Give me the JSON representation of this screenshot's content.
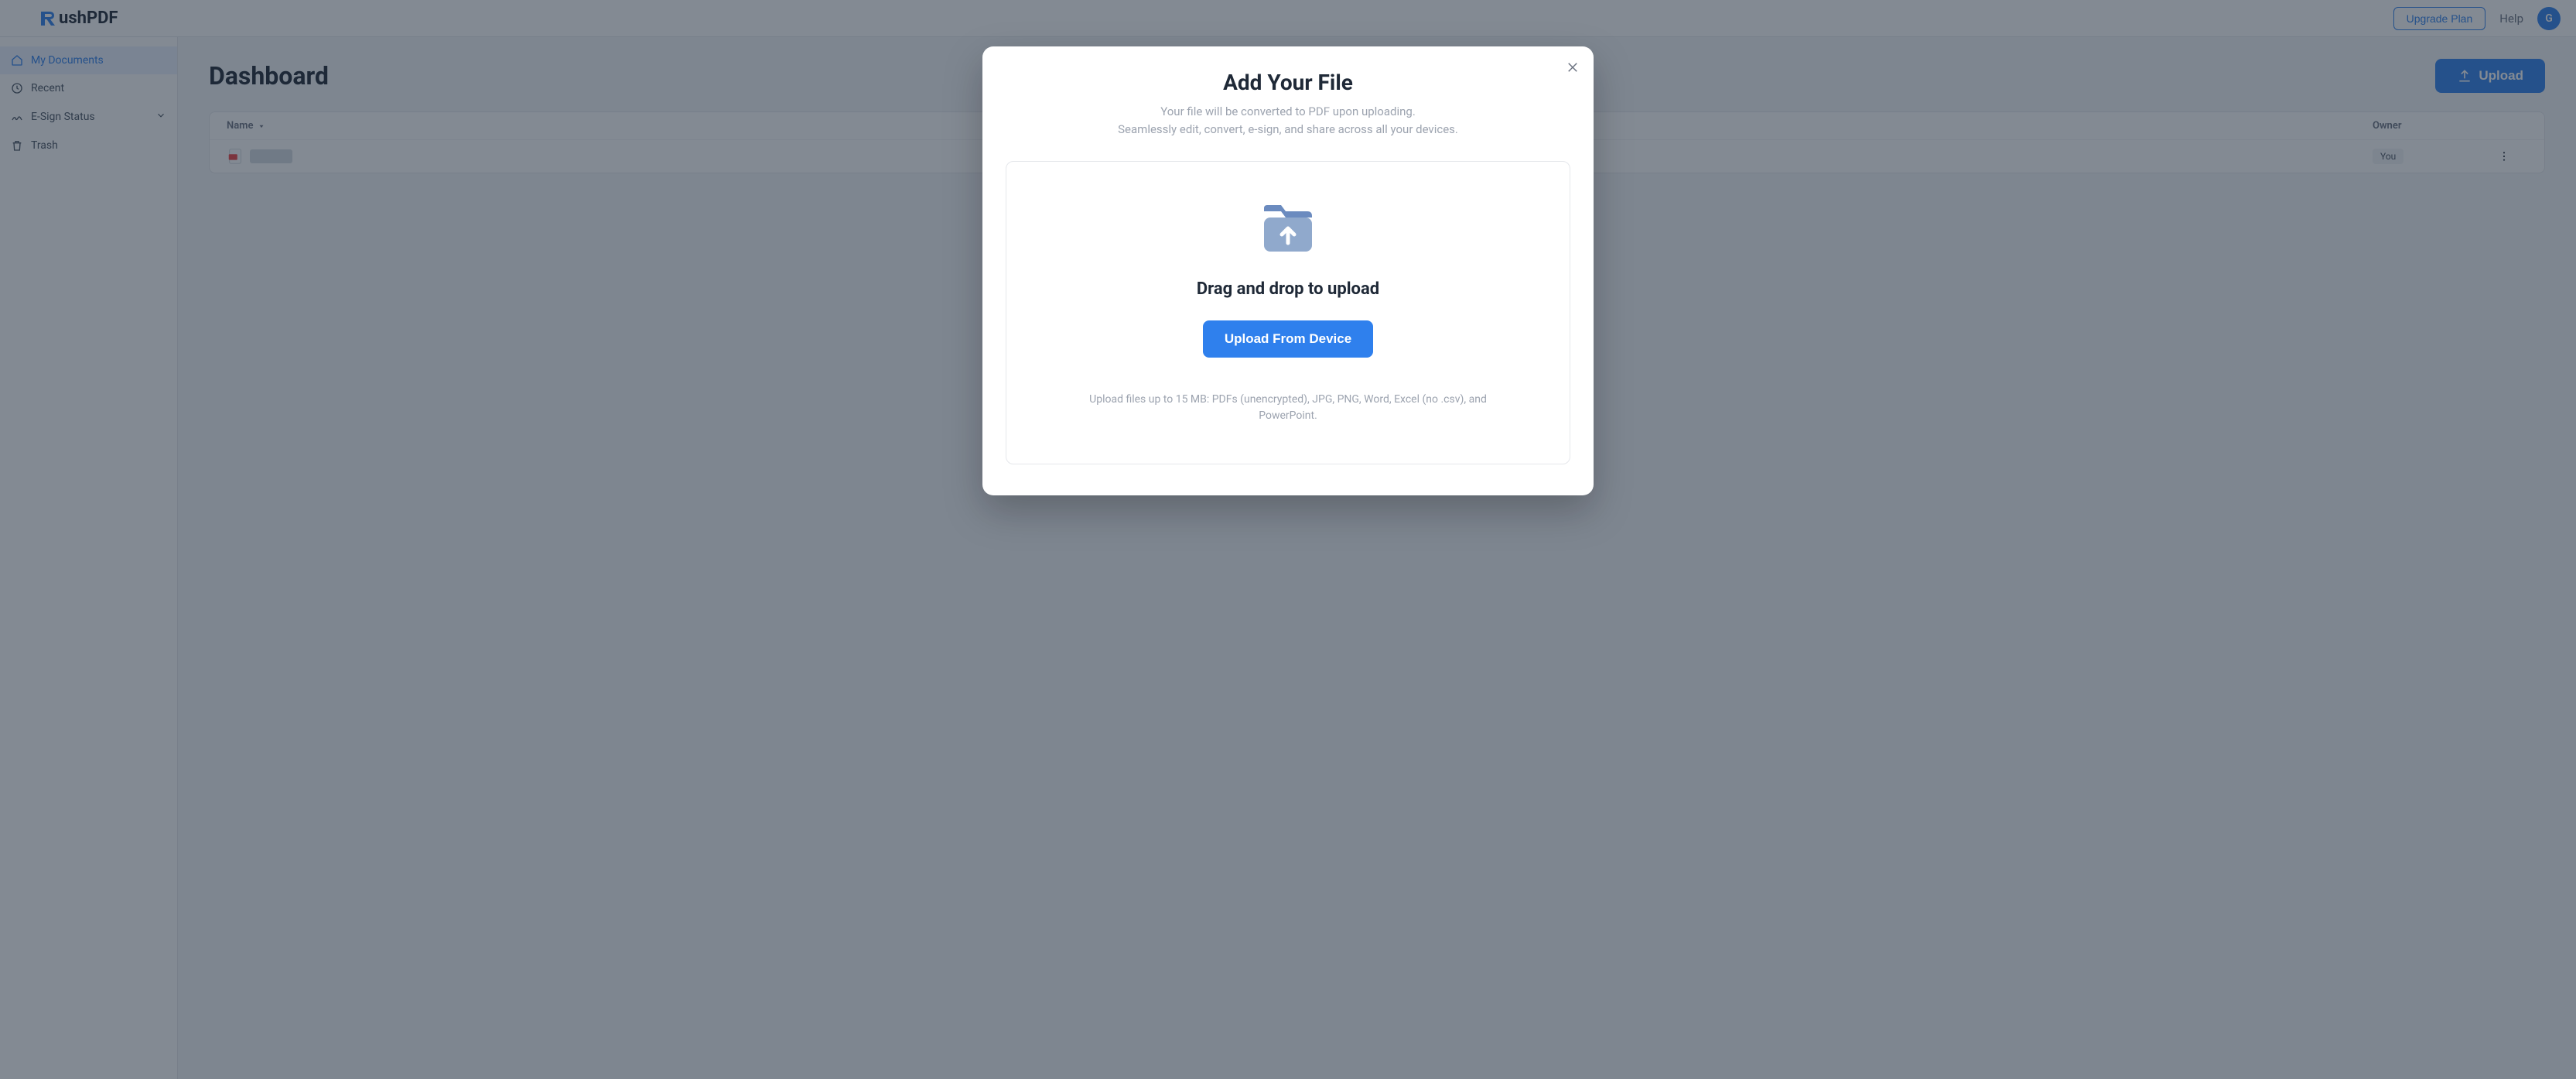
{
  "brand": {
    "name": "ushPDF"
  },
  "header": {
    "upgrade_label": "Upgrade Plan",
    "help_label": "Help",
    "avatar_initial": "G"
  },
  "sidebar": {
    "items": [
      {
        "label": "My Documents"
      },
      {
        "label": "Recent"
      },
      {
        "label": "E-Sign Status"
      },
      {
        "label": "Trash"
      }
    ]
  },
  "dashboard": {
    "title": "Dashboard",
    "upload_label": "Upload",
    "columns": {
      "name": "Name",
      "owner": "Owner"
    },
    "rows": [
      {
        "owner": "You"
      }
    ]
  },
  "modal": {
    "title": "Add Your File",
    "subtitle_line1": "Your file will be converted to PDF upon uploading.",
    "subtitle_line2": "Seamlessly edit, convert, e-sign, and share across all your devices.",
    "dropzone_heading": "Drag and drop to upload",
    "device_button": "Upload From Device",
    "hint": "Upload files up to 15 MB: PDFs (unencrypted), JPG, PNG, Word, Excel (no .csv), and PowerPoint."
  }
}
